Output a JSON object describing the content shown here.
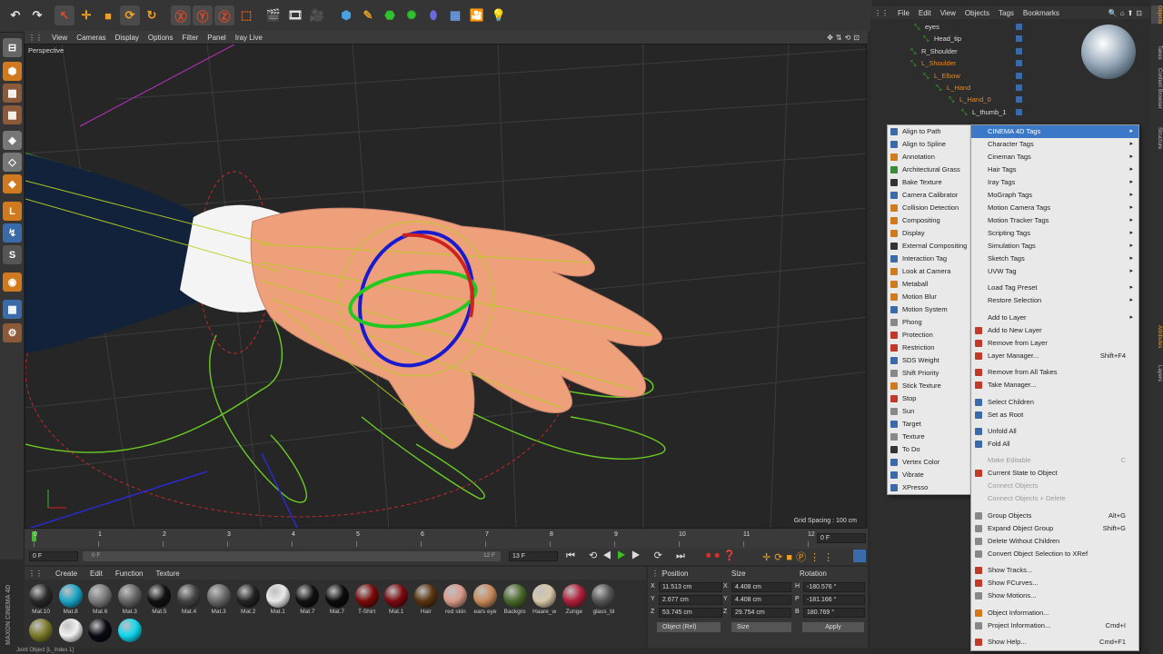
{
  "viewport": {
    "menu": [
      "View",
      "Cameras",
      "Display",
      "Options",
      "Filter",
      "Panel",
      "Iray Live"
    ],
    "label": "Perspective",
    "grid_spacing": "Grid Spacing : 100 cm"
  },
  "timeline": {
    "ticks": [
      "0",
      "1",
      "2",
      "3",
      "4",
      "5",
      "6",
      "7",
      "8",
      "9",
      "10",
      "11",
      "12"
    ],
    "frame_right": "0 F",
    "start_field": "0 F",
    "range_start": "0 F",
    "range_end": "12 F",
    "end_field": "13 F"
  },
  "materials": {
    "menu": [
      "Create",
      "Edit",
      "Function",
      "Texture"
    ],
    "row1": [
      {
        "label": "Mat.10",
        "color": "#2a2a2a"
      },
      {
        "label": "Mat.8",
        "color": "#1aa6c8"
      },
      {
        "label": "Mat.6",
        "color": "#7a7a7a"
      },
      {
        "label": "Mat.3",
        "color": "#666"
      },
      {
        "label": "Mat.5",
        "color": "#111"
      },
      {
        "label": "Mat.4",
        "color": "#444"
      },
      {
        "label": "Mat.3",
        "color": "#6a6a6a"
      },
      {
        "label": "Mat.2",
        "color": "#222"
      },
      {
        "label": "Mat.1",
        "color": "#e8e8e8"
      },
      {
        "label": "Mat.7",
        "color": "#111"
      },
      {
        "label": "Mat.7",
        "color": "#0c0c0c"
      },
      {
        "label": "T-Shirt",
        "color": "#7a0a0a"
      },
      {
        "label": "Mat.1",
        "color": "#7a0a10"
      },
      {
        "label": "Hair",
        "color": "#5a3410"
      },
      {
        "label": "red skin",
        "color": "#d99a8a"
      },
      {
        "label": "ears eye",
        "color": "#c98a5a"
      },
      {
        "label": "Backgro",
        "color": "#4a6a2a"
      },
      {
        "label": "Haare_w",
        "color": "#d8c8a8"
      },
      {
        "label": "Zunge",
        "color": "#b0203a"
      },
      {
        "label": "glass_bl",
        "color": "#555"
      }
    ],
    "row2": [
      {
        "label": "",
        "color": "#7a7a2a"
      },
      {
        "label": "",
        "color": "#f0f0f0"
      },
      {
        "label": "",
        "color": "#0a0a14"
      },
      {
        "label": "",
        "color": "#10d8f0"
      }
    ]
  },
  "coords": {
    "headers": [
      "Position",
      "Size",
      "Rotation"
    ],
    "rows": [
      {
        "axis": "X",
        "pos": "11.513 cm",
        "saxis": "X",
        "size": "4.408 cm",
        "raxis": "H",
        "rot": "-180.576 °"
      },
      {
        "axis": "Y",
        "pos": "2.677 cm",
        "saxis": "Y",
        "size": "4.408 cm",
        "raxis": "P",
        "rot": "-181.166 °"
      },
      {
        "axis": "Z",
        "pos": "53.745 cm",
        "saxis": "Z",
        "size": "29.754 cm",
        "raxis": "B",
        "rot": "180.769 °"
      }
    ],
    "mode": "Object (Rel)",
    "size_mode": "Size",
    "apply": "Apply"
  },
  "status": "Joint Object [L_Index 1]",
  "objmgr": {
    "menu": [
      "File",
      "Edit",
      "View",
      "Objects",
      "Tags",
      "Bookmarks"
    ],
    "rows": [
      {
        "name": "eyes",
        "color": "#ddd",
        "indent": 60
      },
      {
        "name": "Head_tip",
        "color": "#ddd",
        "indent": 70
      },
      {
        "name": "R_Shoulder",
        "color": "#ddd",
        "indent": 56
      },
      {
        "name": "L_Shoulder",
        "color": "#e08a2a",
        "indent": 56
      },
      {
        "name": "L_Elbow",
        "color": "#e08a2a",
        "indent": 70
      },
      {
        "name": "L_Hand",
        "color": "#e08a2a",
        "indent": 84
      },
      {
        "name": "L_Hand_0",
        "color": "#e08a2a",
        "indent": 98
      },
      {
        "name": "L_thumb_1",
        "color": "#ddd",
        "indent": 112
      }
    ]
  },
  "submenu": [
    {
      "label": "Align to Path",
      "icon": "#3a6aa8"
    },
    {
      "label": "Align to Spline",
      "icon": "#3a6aa8"
    },
    {
      "label": "Annotation",
      "icon": "#d07a20"
    },
    {
      "label": "Architectural Grass",
      "icon": "#3a8a3a"
    },
    {
      "label": "Bake Texture",
      "icon": "#333"
    },
    {
      "label": "Camera Calibrator",
      "icon": "#3a6aa8"
    },
    {
      "label": "Collision Detection",
      "icon": "#d07a20"
    },
    {
      "label": "Compositing",
      "icon": "#d07a20"
    },
    {
      "label": "Display",
      "icon": "#d07a20"
    },
    {
      "label": "External Compositing",
      "icon": "#333"
    },
    {
      "label": "Interaction Tag",
      "icon": "#3a6aa8"
    },
    {
      "label": "Look at Camera",
      "icon": "#d07a20"
    },
    {
      "label": "Metaball",
      "icon": "#d07a20"
    },
    {
      "label": "Motion Blur",
      "icon": "#d07a20"
    },
    {
      "label": "Motion System",
      "icon": "#3a6aa8"
    },
    {
      "label": "Phong",
      "icon": "#888"
    },
    {
      "label": "Protection",
      "icon": "#c03a2a"
    },
    {
      "label": "Restriction",
      "icon": "#c03a2a"
    },
    {
      "label": "SDS Weight",
      "icon": "#3a6aa8"
    },
    {
      "label": "Shift Priority",
      "icon": "#888"
    },
    {
      "label": "Stick Texture",
      "icon": "#d07a20"
    },
    {
      "label": "Stop",
      "icon": "#c03a2a"
    },
    {
      "label": "Sun",
      "icon": "#888"
    },
    {
      "label": "Target",
      "icon": "#3a6aa8"
    },
    {
      "label": "Texture",
      "icon": "#888"
    },
    {
      "label": "To Do",
      "icon": "#333"
    },
    {
      "label": "Vertex Color",
      "icon": "#3a6aa8"
    },
    {
      "label": "Vibrate",
      "icon": "#3a6aa8"
    },
    {
      "label": "XPresso",
      "icon": "#3a6aa8"
    }
  ],
  "ctxmenu": [
    {
      "label": "CINEMA 4D Tags",
      "arrow": true,
      "hl": true
    },
    {
      "label": "Character Tags",
      "arrow": true
    },
    {
      "label": "Cineman Tags",
      "arrow": true
    },
    {
      "label": "Hair Tags",
      "arrow": true
    },
    {
      "label": "Iray Tags",
      "arrow": true
    },
    {
      "label": "MoGraph Tags",
      "arrow": true
    },
    {
      "label": "Motion Camera Tags",
      "arrow": true
    },
    {
      "label": "Motion Tracker Tags",
      "arrow": true
    },
    {
      "label": "Scripting Tags",
      "arrow": true
    },
    {
      "label": "Simulation Tags",
      "arrow": true
    },
    {
      "label": "Sketch Tags",
      "arrow": true
    },
    {
      "label": "UVW Tag",
      "arrow": true
    },
    {
      "label": "Load Tag Preset",
      "arrow": true,
      "gap": true
    },
    {
      "label": "Restore Selection",
      "arrow": true
    },
    {
      "label": "Add to Layer",
      "arrow": true,
      "gap": true
    },
    {
      "label": "Add to New Layer",
      "icon": "#c03a2a"
    },
    {
      "label": "Remove from Layer",
      "icon": "#c03a2a"
    },
    {
      "label": "Layer Manager...",
      "icon": "#c03a2a",
      "shortcut": "Shift+F4"
    },
    {
      "label": "Remove from All Takes",
      "icon": "#c03a2a",
      "gap": true
    },
    {
      "label": "Take Manager...",
      "icon": "#c03a2a"
    },
    {
      "label": "Select Children",
      "icon": "#3a6aa8",
      "gap": true
    },
    {
      "label": "Set as Root",
      "icon": "#3a6aa8"
    },
    {
      "label": "Unfold All",
      "icon": "#3a6aa8",
      "gap": true
    },
    {
      "label": "Fold All",
      "icon": "#3a6aa8"
    },
    {
      "label": "Make Editable",
      "dis": true,
      "shortcut": "C",
      "gap": true
    },
    {
      "label": "Current State to Object",
      "icon": "#c03a2a"
    },
    {
      "label": "Connect Objects",
      "dis": true
    },
    {
      "label": "Connect Objects + Delete",
      "dis": true
    },
    {
      "label": "Group Objects",
      "icon": "#888",
      "shortcut": "Alt+G",
      "gap": true
    },
    {
      "label": "Expand Object Group",
      "icon": "#888",
      "shortcut": "Shift+G"
    },
    {
      "label": "Delete Without Children",
      "icon": "#888"
    },
    {
      "label": "Convert Object Selection to XRef",
      "icon": "#888"
    },
    {
      "label": "Show Tracks...",
      "icon": "#c03a2a",
      "gap": true
    },
    {
      "label": "Show FCurves...",
      "icon": "#c03a2a"
    },
    {
      "label": "Show Motions...",
      "icon": "#888"
    },
    {
      "label": "Object Information...",
      "icon": "#d07a20",
      "gap": true
    },
    {
      "label": "Project Information...",
      "icon": "#888",
      "shortcut": "Cmd+I"
    },
    {
      "label": "Show Help...",
      "icon": "#c03a2a",
      "shortcut": "Cmd+F1",
      "gap": true
    }
  ],
  "sidetabs": [
    "Objects",
    "Takes",
    "Content Browser",
    "Structure",
    "Attributes",
    "Layers"
  ],
  "logo": {
    "brand": "MAXON",
    "product": "CINEMA 4D"
  }
}
